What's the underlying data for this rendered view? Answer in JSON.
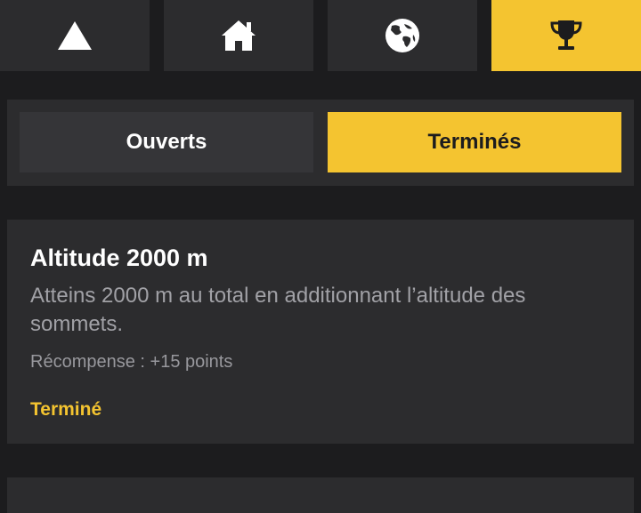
{
  "colors": {
    "background": "#1c1c1e",
    "surface": "#2c2c2e",
    "accent": "#f4c430"
  },
  "tabbar": {
    "tabs": [
      {
        "icon": "mountain-icon",
        "active": false
      },
      {
        "icon": "home-icon",
        "active": false
      },
      {
        "icon": "globe-icon",
        "active": false
      },
      {
        "icon": "trophy-icon",
        "active": true
      }
    ]
  },
  "segment": {
    "open_label": "Ouverts",
    "done_label": "Terminés",
    "selected": "done"
  },
  "challenges": [
    {
      "title": "Altitude 2000 m",
      "description": "Atteins 2000 m au total en additionnant l’altitude des sommets.",
      "reward": "Récompense : +15 points",
      "status": "Terminé"
    }
  ]
}
